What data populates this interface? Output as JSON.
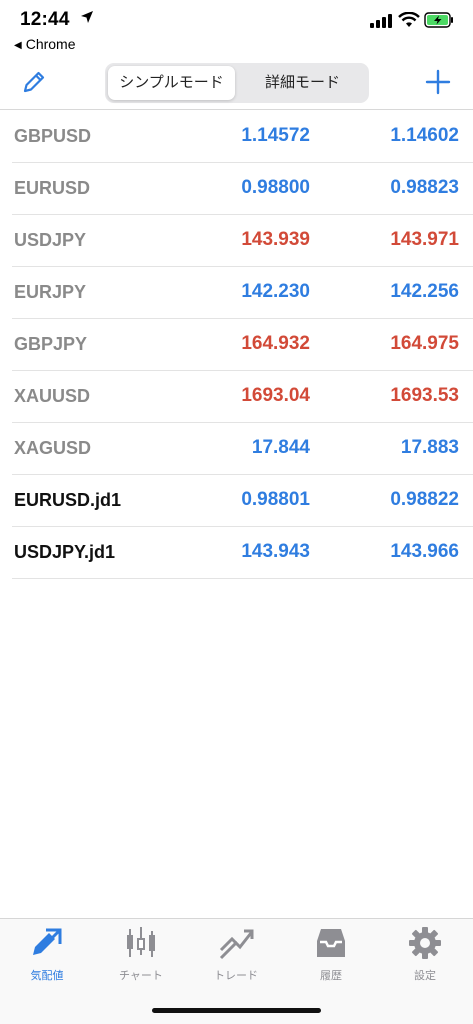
{
  "status_bar": {
    "time": "12:44",
    "back_app": "Chrome"
  },
  "navbar": {
    "segments": [
      "シンプルモード",
      "詳細モード"
    ],
    "active_segment": "シンプルモード"
  },
  "colors": {
    "up": "#2f7de0",
    "down": "#d24a38",
    "accent": "#2f7de0"
  },
  "quotes": [
    {
      "symbol": "GBPUSD",
      "bid": "1.14572",
      "ask": "1.14602",
      "direction": "up",
      "highlight": false
    },
    {
      "symbol": "EURUSD",
      "bid": "0.98800",
      "ask": "0.98823",
      "direction": "up",
      "highlight": false
    },
    {
      "symbol": "USDJPY",
      "bid": "143.939",
      "ask": "143.971",
      "direction": "down",
      "highlight": false
    },
    {
      "symbol": "EURJPY",
      "bid": "142.230",
      "ask": "142.256",
      "direction": "up",
      "highlight": false
    },
    {
      "symbol": "GBPJPY",
      "bid": "164.932",
      "ask": "164.975",
      "direction": "down",
      "highlight": false
    },
    {
      "symbol": "XAUUSD",
      "bid": "1693.04",
      "ask": "1693.53",
      "direction": "down",
      "highlight": false
    },
    {
      "symbol": "XAGUSD",
      "bid": "17.844",
      "ask": "17.883",
      "direction": "up",
      "highlight": false
    },
    {
      "symbol": "EURUSD.jd1",
      "bid": "0.98801",
      "ask": "0.98822",
      "direction": "up",
      "highlight": true
    },
    {
      "symbol": "USDJPY.jd1",
      "bid": "143.943",
      "ask": "143.966",
      "direction": "up",
      "highlight": true
    }
  ],
  "tabs": [
    {
      "label": "気配値",
      "icon": "quotes-icon",
      "active": true
    },
    {
      "label": "チャート",
      "icon": "candlestick-chart-icon",
      "active": false
    },
    {
      "label": "トレード",
      "icon": "trade-icon",
      "active": false
    },
    {
      "label": "履歴",
      "icon": "history-tray-icon",
      "active": false
    },
    {
      "label": "設定",
      "icon": "gear-icon",
      "active": false
    }
  ]
}
